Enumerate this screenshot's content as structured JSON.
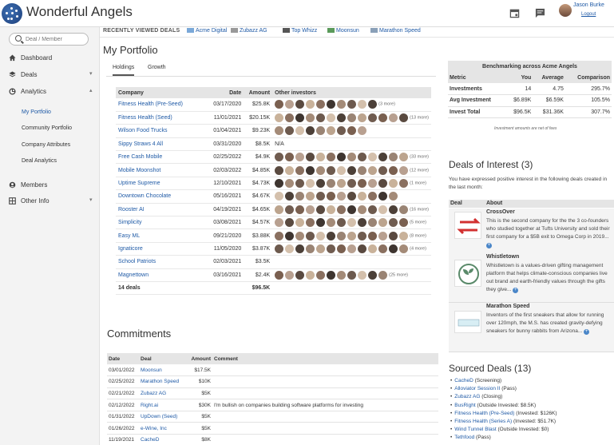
{
  "app": {
    "title": "Wonderful Angels",
    "user_name": "Jason Burke",
    "logout_label": "Logout"
  },
  "search": {
    "placeholder": "Deal / Member"
  },
  "nav": {
    "dashboard": "Dashboard",
    "deals": "Deals",
    "analytics": "Analytics",
    "sub": [
      "My Portfolio",
      "Community Portfolio",
      "Company Attributes",
      "Deal Analytics"
    ],
    "members": "Members",
    "other": "Other Info"
  },
  "recent": {
    "label": "RECENTLY VIEWED DEALS",
    "items": [
      "Acme Digital",
      "Zubazz AG",
      "Top Whizz",
      "Moonsun",
      "Marathon Speed"
    ]
  },
  "page": {
    "title": "My Portfolio",
    "tabs": [
      "Holdings",
      "Growth"
    ]
  },
  "portfolio": {
    "headers": [
      "Company",
      "Date",
      "Amount",
      "Other investors"
    ],
    "rows": [
      {
        "company": "Fitness Health (Pre-Seed)",
        "date": "03/17/2020",
        "amount": "$25.8K",
        "investors": 10,
        "more": "(3 more)"
      },
      {
        "company": "Fitness Health (Seed)",
        "date": "11/01/2021",
        "amount": "$20.15K",
        "investors": 13,
        "more": "(13 more)"
      },
      {
        "company": "Wilson Food Trucks",
        "date": "01/04/2021",
        "amount": "$9.23K",
        "investors": 9,
        "more": ""
      },
      {
        "company": "Sippy Straws 4 All",
        "date": "03/31/2020",
        "amount": "$8.5K",
        "investors": 0,
        "more": "N/A"
      },
      {
        "company": "Free Cash Mobile",
        "date": "02/25/2022",
        "amount": "$4.9K",
        "investors": 13,
        "more": "(33 more)"
      },
      {
        "company": "Mobile Moonshot",
        "date": "02/03/2022",
        "amount": "$4.85K",
        "investors": 13,
        "more": "(12 more)"
      },
      {
        "company": "Uptime Supreme",
        "date": "12/10/2021",
        "amount": "$4.73K",
        "investors": 13,
        "more": "(1 more)"
      },
      {
        "company": "Downtown Chocolate",
        "date": "05/16/2021",
        "amount": "$4.67K",
        "investors": 12,
        "more": ""
      },
      {
        "company": "Rooster AI",
        "date": "04/19/2021",
        "amount": "$4.65K",
        "investors": 13,
        "more": "(16 more)"
      },
      {
        "company": "Simplicity",
        "date": "03/08/2021",
        "amount": "$4.57K",
        "investors": 13,
        "more": "(5 more)"
      },
      {
        "company": "Easy ML",
        "date": "09/21/2020",
        "amount": "$3.88K",
        "investors": 13,
        "more": "(8 more)"
      },
      {
        "company": "Ignaticore",
        "date": "11/05/2020",
        "amount": "$3.87K",
        "investors": 13,
        "more": "(4 more)"
      },
      {
        "company": "School Patriots",
        "date": "02/03/2021",
        "amount": "$3.5K",
        "investors": 0,
        "more": ""
      },
      {
        "company": "Magnettown",
        "date": "03/16/2021",
        "amount": "$2.4K",
        "investors": 11,
        "more": "(25 more)"
      }
    ],
    "footer_deals": "14 deals",
    "footer_amount": "$96.5K"
  },
  "benchmark": {
    "title": "Benchmarking across Acme Angels",
    "headers": [
      "Metric",
      "You",
      "Average",
      "Comparison"
    ],
    "rows": [
      {
        "metric": "Investments",
        "you": "14",
        "avg": "4.75",
        "cmp": "295.7%"
      },
      {
        "metric": "Avg Investment",
        "you": "$6.89K",
        "avg": "$6.59K",
        "cmp": "105.5%"
      },
      {
        "metric": "Invest Total",
        "you": "$96.5K",
        "avg": "$31.36K",
        "cmp": "307.7%"
      }
    ],
    "note": "Investment amounts are net of fees"
  },
  "deals_of_interest": {
    "title": "Deals of Interest (3)",
    "desc": "You have expressed positive interest in the following deals created in the last month:",
    "headers": [
      "Deal",
      "About"
    ],
    "items": [
      {
        "name": "CrossOver",
        "text": "This is the second company for the the 3 co-founders who studied together at Tufts University and sold their first company for a $5B exit to Omega Corp in 2019..."
      },
      {
        "name": "Whistletown",
        "text": "Whistletown is a values-driven gifting management platform that helps climate-conscious companies live out brand and earth-friendly values through the gifts they give..."
      },
      {
        "name": "Marathon Speed",
        "text": "Inventors of the first sneakers that allow for running over 120mph, the M.S. has created gravity-defying sneakers for bunny rabbits from Arizona..."
      }
    ]
  },
  "sourced": {
    "title": "Sourced Deals (13)",
    "items": [
      {
        "name": "CacheD",
        "status": "(Screening)"
      },
      {
        "name": "Alloviator Session II",
        "status": "(Pass)"
      },
      {
        "name": "Zubazz AG",
        "status": "(Closing)"
      },
      {
        "name": "BusRight",
        "status": "(Outside Invested: $8.5K)"
      },
      {
        "name": "Fitness Health (Pre-Seed)",
        "status": "(Invested: $126K)"
      },
      {
        "name": "Fitness Health (Series A)",
        "status": "(Invested: $51.7K)"
      },
      {
        "name": "Wind Tunnel Blast",
        "status": "(Outside Invested: $0)"
      },
      {
        "name": "Tethfood",
        "status": "(Pass)"
      }
    ]
  },
  "commitments": {
    "title": "Commitments",
    "headers": [
      "Date",
      "Deal",
      "Amount",
      "Comment"
    ],
    "rows": [
      {
        "date": "03/01/2022",
        "deal": "Moonsun",
        "amount": "$17.5K",
        "comment": ""
      },
      {
        "date": "02/25/2022",
        "deal": "Marathon Speed",
        "amount": "$10K",
        "comment": ""
      },
      {
        "date": "02/21/2022",
        "deal": "Zubazz AG",
        "amount": "$5K",
        "comment": ""
      },
      {
        "date": "02/12/2022",
        "deal": "Right.ai",
        "amount": "$30K",
        "comment": "I'm bullish on companies building software platforms for investing"
      },
      {
        "date": "01/31/2022",
        "deal": "UpDown (Seed)",
        "amount": "$5K",
        "comment": ""
      },
      {
        "date": "01/26/2022",
        "deal": "e-Wine, Inc",
        "amount": "$5K",
        "comment": ""
      },
      {
        "date": "11/19/2021",
        "deal": "CacheD",
        "amount": "$8K",
        "comment": ""
      }
    ]
  }
}
